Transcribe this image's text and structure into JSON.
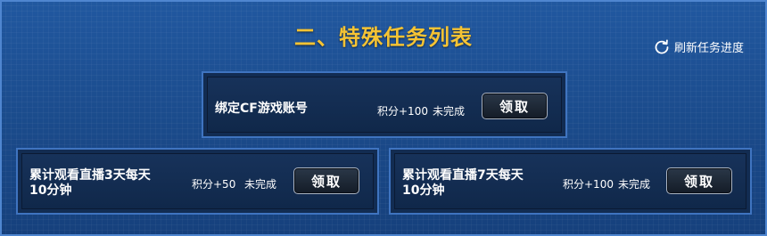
{
  "section": {
    "title": "二、特殊任务列表"
  },
  "refresh": {
    "label": "刷新任务进度",
    "icon": "refresh-icon"
  },
  "tasks": [
    {
      "name_lines": [
        "绑定CF游戏账号"
      ],
      "points": "积分+100",
      "status": "未完成",
      "button": "领取"
    },
    {
      "name_lines": [
        "累计观看直播3天每天",
        "10分钟"
      ],
      "points": "积分+50",
      "status": "未完成",
      "button": "领取"
    },
    {
      "name_lines": [
        "累计观看直播7天每天",
        "10分钟"
      ],
      "points": "积分+100",
      "status": "未完成",
      "button": "领取"
    }
  ],
  "colors": {
    "title": "#f5c334",
    "background": "#1b4a8a",
    "card_border": "#3f74c0",
    "card_fill": "#122c52"
  }
}
